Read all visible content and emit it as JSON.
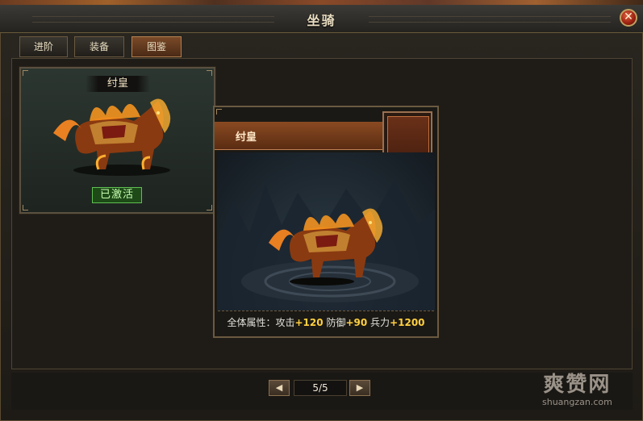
{
  "window": {
    "title": "坐骑"
  },
  "tabs": [
    {
      "label": "进阶"
    },
    {
      "label": "装备"
    },
    {
      "label": "图鉴"
    }
  ],
  "card": {
    "name": "纣皇",
    "status": "已激活"
  },
  "tooltip": {
    "name": "纣皇",
    "stats_label": "全体属性：",
    "attack_label": "攻击",
    "attack_value": "+120",
    "defense_label": "防御",
    "defense_value": "+90",
    "troops_label": "兵力",
    "troops_value": "+1200"
  },
  "pagination": {
    "text": "5/5",
    "prev_icon": "arrow-left-icon",
    "next_icon": "arrow-right-icon"
  },
  "watermark": {
    "main": "爽赞网",
    "sub": "shuangzan.com"
  },
  "colors": {
    "accent": "#ffd040",
    "active_green": "#5fbf50",
    "tab_active": "#7a4a28"
  }
}
